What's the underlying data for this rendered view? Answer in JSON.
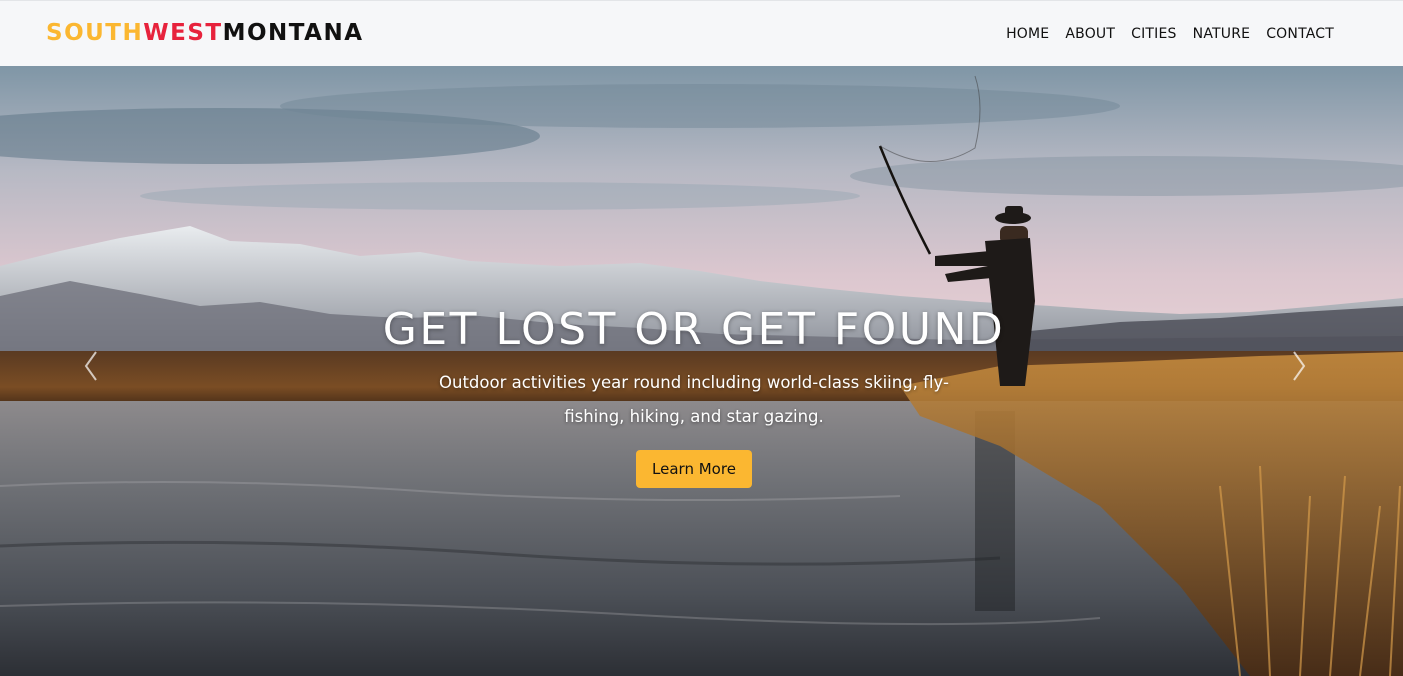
{
  "brand": {
    "part1": "SOUTH",
    "part2": "WEST",
    "part3": "MONTANA"
  },
  "nav": {
    "items": [
      {
        "label": "HOME"
      },
      {
        "label": "ABOUT"
      },
      {
        "label": "CITIES"
      },
      {
        "label": "NATURE"
      },
      {
        "label": "CONTACT"
      }
    ]
  },
  "hero": {
    "title": "GET LOST OR GET FOUND",
    "text": "Outdoor activities year round including world-class skiing, fly-fishing, hiking, and star gazing.",
    "button_label": "Learn More",
    "prev_icon": "chevron-left-icon",
    "next_icon": "chevron-right-icon"
  },
  "colors": {
    "brand_yellow": "#fbb731",
    "brand_red": "#e7223c",
    "brand_dark": "#111111",
    "navbar_bg": "#f6f7f9",
    "button_bg": "#fbb731"
  }
}
